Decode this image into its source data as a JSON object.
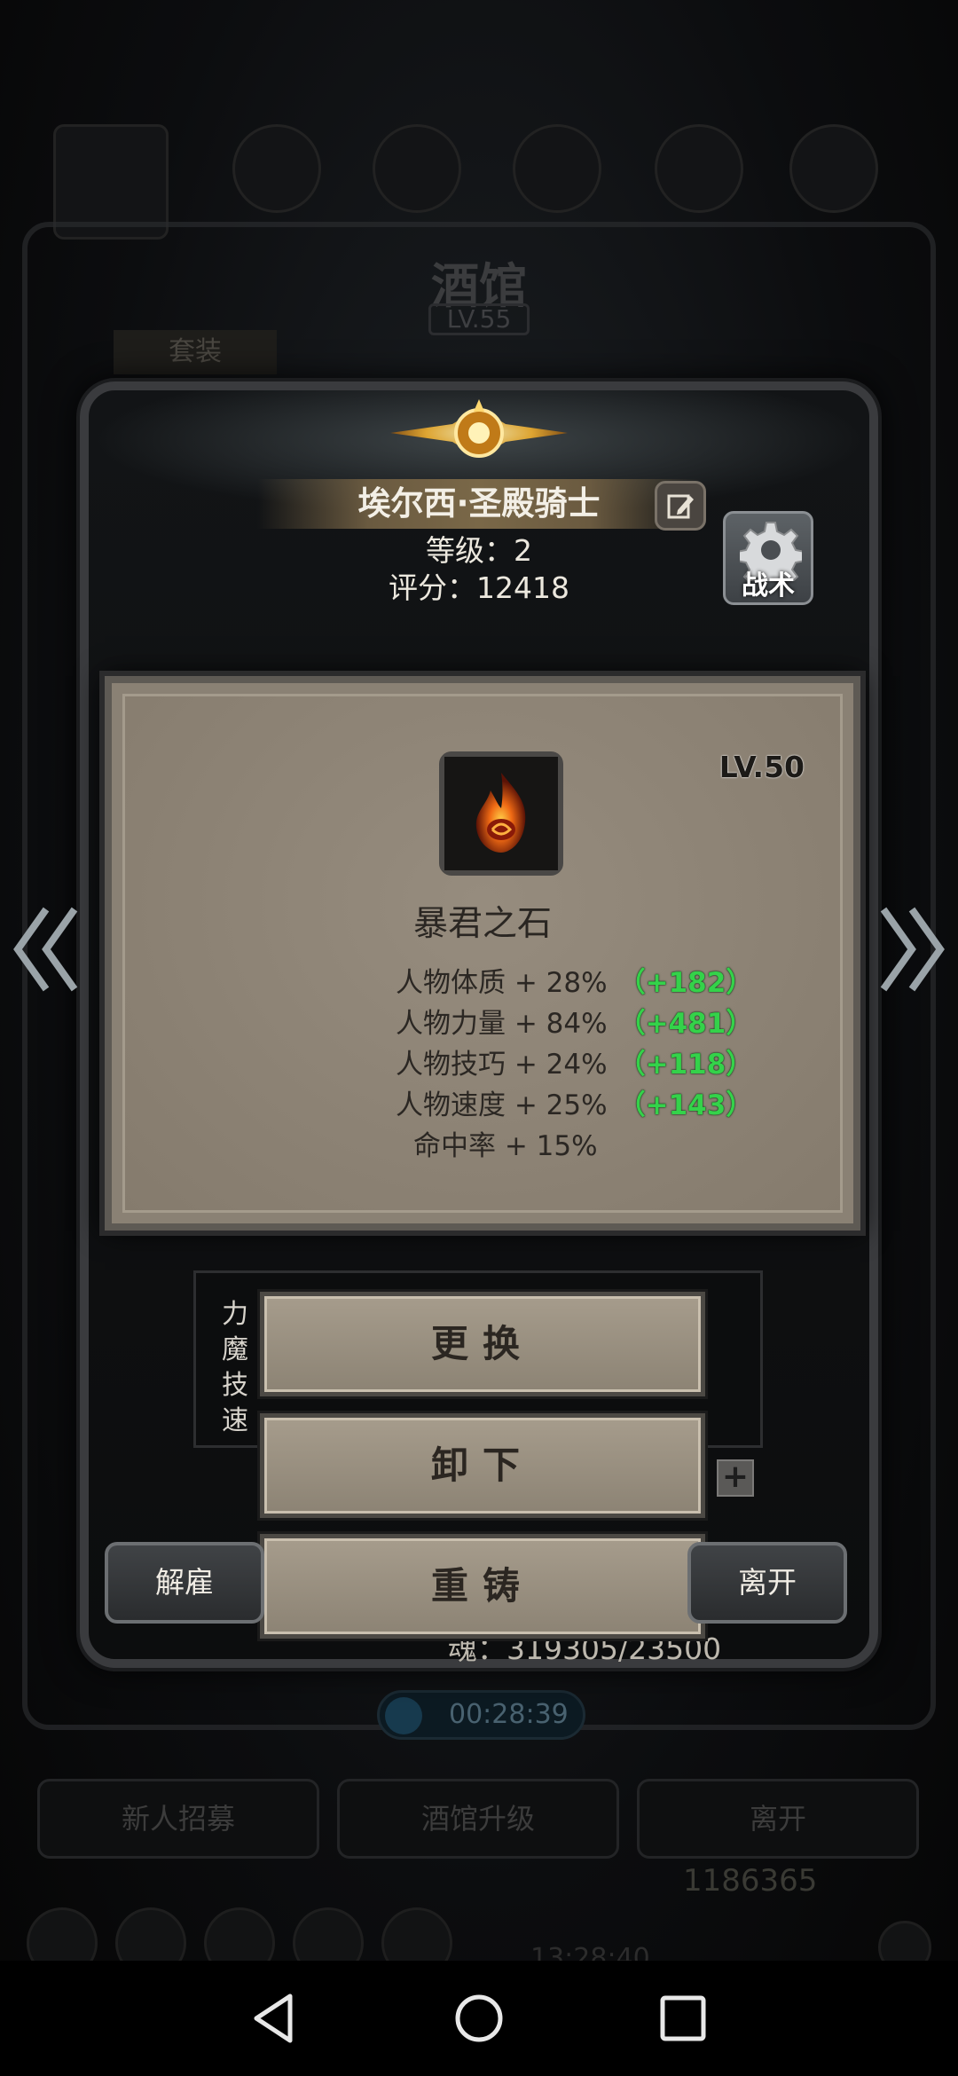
{
  "background": {
    "title": "酒馆",
    "level": "LV.55",
    "suit_tab": "套装",
    "timer": "00:28:39",
    "buttons": [
      "新人招募",
      "酒馆升级",
      "离开"
    ],
    "gold": "1186365",
    "clock": "13:28:40"
  },
  "character": {
    "name": "埃尔西·圣殿骑士",
    "level_line": "等级：2",
    "score_line": "评分：12418",
    "tactics_label": "战术"
  },
  "item": {
    "level": "LV.50",
    "name": "暴君之石",
    "stats": [
      {
        "text": "人物体质 + 28%",
        "bonus": "（+182）"
      },
      {
        "text": "人物力量 + 84%",
        "bonus": "（+481）"
      },
      {
        "text": "人物技巧 + 24%",
        "bonus": "（+118）"
      },
      {
        "text": "人物速度 + 25%",
        "bonus": "（+143）"
      },
      {
        "text": "命中率 + 15%",
        "bonus": ""
      }
    ]
  },
  "attributes": {
    "labels": [
      "力",
      "魔",
      "技",
      "速"
    ],
    "soul": "魂：319305/23500"
  },
  "actions": {
    "replace": "更换",
    "unequip": "卸下",
    "reforge": "重铸",
    "dismiss": "解雇",
    "leave": "离开"
  },
  "icons": {
    "back": "nav-back-icon",
    "home": "nav-home-icon",
    "recent": "nav-recent-icon",
    "gear": "gear-icon",
    "edit": "edit-icon",
    "fire": "fire-stone-icon"
  },
  "colors": {
    "bonus_green": "#34d24a",
    "popup_bg": "#8a8174"
  }
}
